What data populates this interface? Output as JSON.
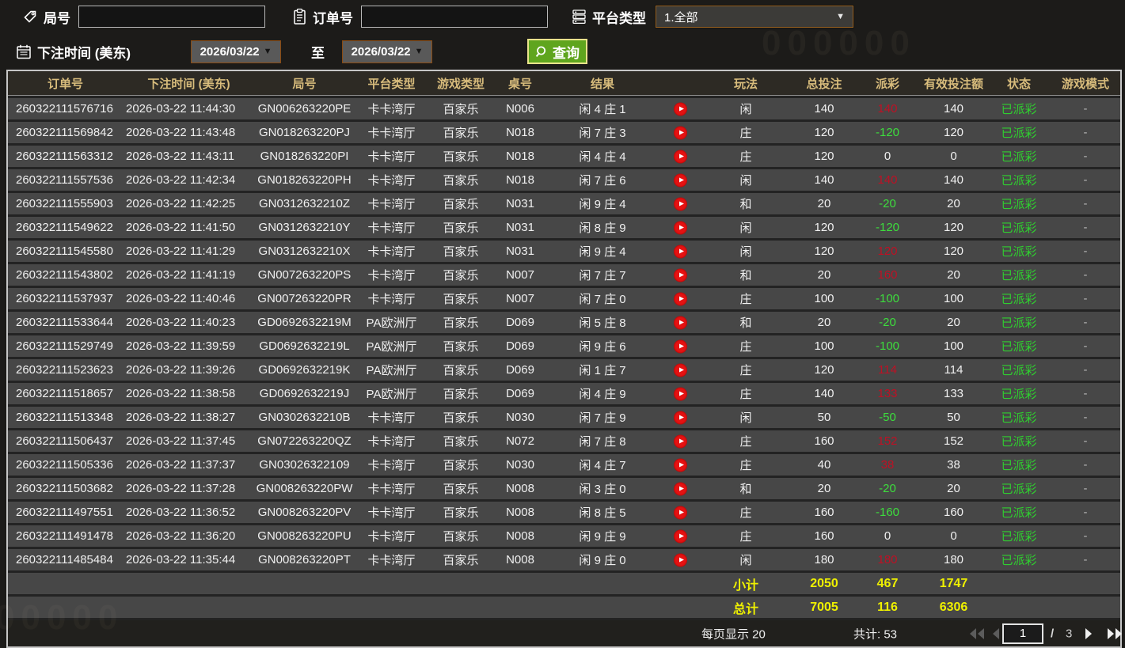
{
  "filters": {
    "game_no_label": "局号",
    "order_no_label": "订单号",
    "platform_label": "平台类型",
    "platform_value": "1.全部",
    "bet_time_label": "下注时间 (美东)",
    "date_from": "2026/03/22",
    "date_to": "2026/03/22",
    "to_label": "至",
    "search_label": "查询"
  },
  "watermark": {
    "top": "000000",
    "bottom": "00000"
  },
  "table": {
    "headers": [
      "订单号",
      "下注时间 (美东)",
      "局号",
      "平台类型",
      "游戏类型",
      "桌号",
      "结果",
      "玩法",
      "总投注",
      "派彩",
      "有效投注额",
      "状态",
      "游戏模式"
    ],
    "rows": [
      {
        "order": "260322111576716",
        "time": "2026-03-22 11:44:30",
        "game_no": "GN006263220PE",
        "platform": "卡卡湾厅",
        "game_type": "百家乐",
        "table_no": "N006",
        "result": "闲 4 庄 1",
        "play": "闲",
        "total_bet": "140",
        "payout": "140",
        "payout_class": "pos",
        "valid_bet": "140",
        "status": "已派彩",
        "mode": "-"
      },
      {
        "order": "260322111569842",
        "time": "2026-03-22 11:43:48",
        "game_no": "GN018263220PJ",
        "platform": "卡卡湾厅",
        "game_type": "百家乐",
        "table_no": "N018",
        "result": "闲 7 庄 3",
        "play": "庄",
        "total_bet": "120",
        "payout": "-120",
        "payout_class": "neg",
        "valid_bet": "120",
        "status": "已派彩",
        "mode": "-"
      },
      {
        "order": "260322111563312",
        "time": "2026-03-22 11:43:11",
        "game_no": "GN018263220PI",
        "platform": "卡卡湾厅",
        "game_type": "百家乐",
        "table_no": "N018",
        "result": "闲 4 庄 4",
        "play": "庄",
        "total_bet": "120",
        "payout": "0",
        "payout_class": "zero",
        "valid_bet": "0",
        "status": "已派彩",
        "mode": "-"
      },
      {
        "order": "260322111557536",
        "time": "2026-03-22 11:42:34",
        "game_no": "GN018263220PH",
        "platform": "卡卡湾厅",
        "game_type": "百家乐",
        "table_no": "N018",
        "result": "闲 7 庄 6",
        "play": "闲",
        "total_bet": "140",
        "payout": "140",
        "payout_class": "pos",
        "valid_bet": "140",
        "status": "已派彩",
        "mode": "-"
      },
      {
        "order": "260322111555903",
        "time": "2026-03-22 11:42:25",
        "game_no": "GN0312632210Z",
        "platform": "卡卡湾厅",
        "game_type": "百家乐",
        "table_no": "N031",
        "result": "闲 9 庄 4",
        "play": "和",
        "total_bet": "20",
        "payout": "-20",
        "payout_class": "neg",
        "valid_bet": "20",
        "status": "已派彩",
        "mode": "-"
      },
      {
        "order": "260322111549622",
        "time": "2026-03-22 11:41:50",
        "game_no": "GN0312632210Y",
        "platform": "卡卡湾厅",
        "game_type": "百家乐",
        "table_no": "N031",
        "result": "闲 8 庄 9",
        "play": "闲",
        "total_bet": "120",
        "payout": "-120",
        "payout_class": "neg",
        "valid_bet": "120",
        "status": "已派彩",
        "mode": "-"
      },
      {
        "order": "260322111545580",
        "time": "2026-03-22 11:41:29",
        "game_no": "GN0312632210X",
        "platform": "卡卡湾厅",
        "game_type": "百家乐",
        "table_no": "N031",
        "result": "闲 9 庄 4",
        "play": "闲",
        "total_bet": "120",
        "payout": "120",
        "payout_class": "pos",
        "valid_bet": "120",
        "status": "已派彩",
        "mode": "-"
      },
      {
        "order": "260322111543802",
        "time": "2026-03-22 11:41:19",
        "game_no": "GN007263220PS",
        "platform": "卡卡湾厅",
        "game_type": "百家乐",
        "table_no": "N007",
        "result": "闲 7 庄 7",
        "play": "和",
        "total_bet": "20",
        "payout": "160",
        "payout_class": "pos",
        "valid_bet": "20",
        "status": "已派彩",
        "mode": "-"
      },
      {
        "order": "260322111537937",
        "time": "2026-03-22 11:40:46",
        "game_no": "GN007263220PR",
        "platform": "卡卡湾厅",
        "game_type": "百家乐",
        "table_no": "N007",
        "result": "闲 7 庄 0",
        "play": "庄",
        "total_bet": "100",
        "payout": "-100",
        "payout_class": "neg",
        "valid_bet": "100",
        "status": "已派彩",
        "mode": "-"
      },
      {
        "order": "260322111533644",
        "time": "2026-03-22 11:40:23",
        "game_no": "GD0692632219M",
        "platform": "PA欧洲厅",
        "game_type": "百家乐",
        "table_no": "D069",
        "result": "闲 5 庄 8",
        "play": "和",
        "total_bet": "20",
        "payout": "-20",
        "payout_class": "neg",
        "valid_bet": "20",
        "status": "已派彩",
        "mode": "-"
      },
      {
        "order": "260322111529749",
        "time": "2026-03-22 11:39:59",
        "game_no": "GD0692632219L",
        "platform": "PA欧洲厅",
        "game_type": "百家乐",
        "table_no": "D069",
        "result": "闲 9 庄 6",
        "play": "庄",
        "total_bet": "100",
        "payout": "-100",
        "payout_class": "neg",
        "valid_bet": "100",
        "status": "已派彩",
        "mode": "-"
      },
      {
        "order": "260322111523623",
        "time": "2026-03-22 11:39:26",
        "game_no": "GD0692632219K",
        "platform": "PA欧洲厅",
        "game_type": "百家乐",
        "table_no": "D069",
        "result": "闲 1 庄 7",
        "play": "庄",
        "total_bet": "120",
        "payout": "114",
        "payout_class": "pos",
        "valid_bet": "114",
        "status": "已派彩",
        "mode": "-"
      },
      {
        "order": "260322111518657",
        "time": "2026-03-22 11:38:58",
        "game_no": "GD0692632219J",
        "platform": "PA欧洲厅",
        "game_type": "百家乐",
        "table_no": "D069",
        "result": "闲 4 庄 9",
        "play": "庄",
        "total_bet": "140",
        "payout": "133",
        "payout_class": "pos",
        "valid_bet": "133",
        "status": "已派彩",
        "mode": "-"
      },
      {
        "order": "260322111513348",
        "time": "2026-03-22 11:38:27",
        "game_no": "GN0302632210B",
        "platform": "卡卡湾厅",
        "game_type": "百家乐",
        "table_no": "N030",
        "result": "闲 7 庄 9",
        "play": "闲",
        "total_bet": "50",
        "payout": "-50",
        "payout_class": "neg",
        "valid_bet": "50",
        "status": "已派彩",
        "mode": "-"
      },
      {
        "order": "260322111506437",
        "time": "2026-03-22 11:37:45",
        "game_no": "GN072263220QZ",
        "platform": "卡卡湾厅",
        "game_type": "百家乐",
        "table_no": "N072",
        "result": "闲 7 庄 8",
        "play": "庄",
        "total_bet": "160",
        "payout": "152",
        "payout_class": "pos",
        "valid_bet": "152",
        "status": "已派彩",
        "mode": "-"
      },
      {
        "order": "260322111505336",
        "time": "2026-03-22 11:37:37",
        "game_no": "GN03026322109",
        "platform": "卡卡湾厅",
        "game_type": "百家乐",
        "table_no": "N030",
        "result": "闲 4 庄 7",
        "play": "庄",
        "total_bet": "40",
        "payout": "38",
        "payout_class": "pos",
        "valid_bet": "38",
        "status": "已派彩",
        "mode": "-"
      },
      {
        "order": "260322111503682",
        "time": "2026-03-22 11:37:28",
        "game_no": "GN008263220PW",
        "platform": "卡卡湾厅",
        "game_type": "百家乐",
        "table_no": "N008",
        "result": "闲 3 庄 0",
        "play": "和",
        "total_bet": "20",
        "payout": "-20",
        "payout_class": "neg",
        "valid_bet": "20",
        "status": "已派彩",
        "mode": "-"
      },
      {
        "order": "260322111497551",
        "time": "2026-03-22 11:36:52",
        "game_no": "GN008263220PV",
        "platform": "卡卡湾厅",
        "game_type": "百家乐",
        "table_no": "N008",
        "result": "闲 8 庄 5",
        "play": "庄",
        "total_bet": "160",
        "payout": "-160",
        "payout_class": "neg",
        "valid_bet": "160",
        "status": "已派彩",
        "mode": "-"
      },
      {
        "order": "260322111491478",
        "time": "2026-03-22 11:36:20",
        "game_no": "GN008263220PU",
        "platform": "卡卡湾厅",
        "game_type": "百家乐",
        "table_no": "N008",
        "result": "闲 9 庄 9",
        "play": "庄",
        "total_bet": "160",
        "payout": "0",
        "payout_class": "zero",
        "valid_bet": "0",
        "status": "已派彩",
        "mode": "-"
      },
      {
        "order": "260322111485484",
        "time": "2026-03-22 11:35:44",
        "game_no": "GN008263220PT",
        "platform": "卡卡湾厅",
        "game_type": "百家乐",
        "table_no": "N008",
        "result": "闲 9 庄 0",
        "play": "闲",
        "total_bet": "180",
        "payout": "180",
        "payout_class": "pos",
        "valid_bet": "180",
        "status": "已派彩",
        "mode": "-"
      }
    ],
    "subtotal": {
      "label": "小计",
      "total_bet": "2050",
      "payout": "467",
      "valid_bet": "1747"
    },
    "grand_total": {
      "label": "总计",
      "total_bet": "7005",
      "payout": "116",
      "valid_bet": "6306"
    }
  },
  "pagination": {
    "per_page_text": "每页显示 20",
    "total_text": "共计: 53",
    "current_page": "1",
    "separator": "/",
    "total_pages": "3"
  },
  "colors": {
    "accent_gold": "#d8bc7c",
    "payout_positive": "#bf1024",
    "payout_negative": "#3ddd3d",
    "status_green": "#2fcf2f",
    "totals_yellow": "#eef000",
    "search_green": "#5fa51e",
    "date_border_orange": "#8a4b12"
  }
}
